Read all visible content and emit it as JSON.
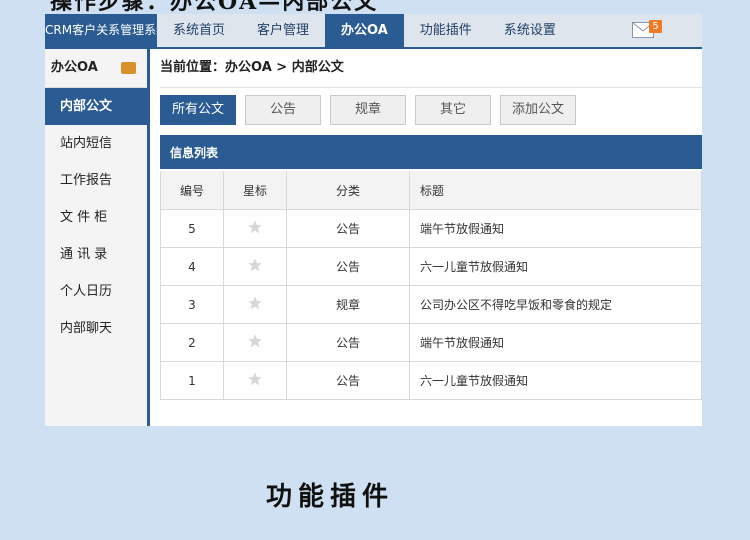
{
  "caption": {
    "top": "操作步骤：办公OA—内部公文",
    "bottom": "功能插件"
  },
  "app": {
    "logo": "CRM客户关系管理系统",
    "nav": [
      "系统首页",
      "客户管理",
      "办公OA",
      "功能插件",
      "系统设置"
    ],
    "active_nav": 2,
    "mail_count": "5"
  },
  "sidebar": {
    "title": "办公OA",
    "items": [
      "内部公文",
      "站内短信",
      "工作报告",
      "文 件 柜",
      "通 讯 录",
      "个人日历",
      "内部聊天"
    ],
    "active_item": 0
  },
  "main": {
    "breadcrumb": "当前位置：办公OA > 内部公文",
    "buttons": [
      "所有公文",
      "公告",
      "规章",
      "其它",
      "添加公文"
    ],
    "panel_title": "信息列表",
    "columns": [
      "编号",
      "星标",
      "分类",
      "标题"
    ],
    "rows": [
      {
        "id": "5",
        "category": "公告",
        "title": "端午节放假通知"
      },
      {
        "id": "4",
        "category": "公告",
        "title": "六一儿童节放假通知"
      },
      {
        "id": "3",
        "category": "规章",
        "title": "公司办公区不得吃早饭和零食的规定"
      },
      {
        "id": "2",
        "category": "公告",
        "title": "端午节放假通知"
      },
      {
        "id": "1",
        "category": "公告",
        "title": "六一儿童节放假通知"
      }
    ]
  },
  "colors": {
    "primary": "#2a5b93",
    "page_bg": "#cfe0f2",
    "badge": "#f07a24",
    "star": "#d7d7d7"
  },
  "icons": {
    "mail": "mail-icon",
    "wallet": "wallet-icon",
    "star": "star-icon"
  }
}
